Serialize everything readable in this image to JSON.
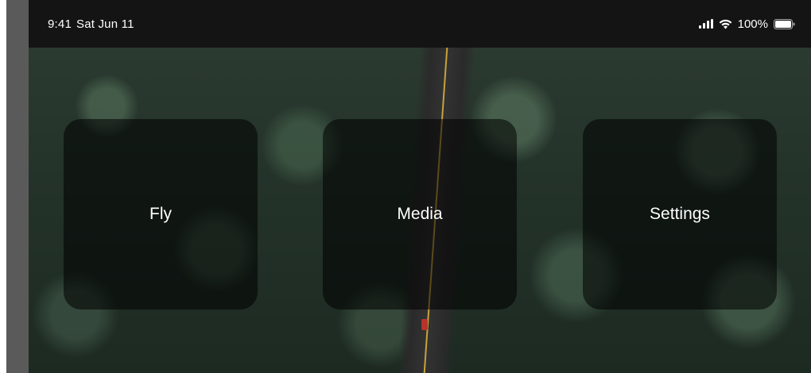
{
  "status_bar": {
    "time": "9:41",
    "date": "Sat Jun 11",
    "battery": "100%"
  },
  "icons": {
    "signal": "cellular-signal-icon",
    "wifi": "wifi-icon",
    "battery": "battery-icon"
  },
  "menu": {
    "fly_label": "Fly",
    "media_label": "Media",
    "settings_label": "Settings"
  },
  "colors": {
    "tile_background": "rgba(0,0,0,0.55)",
    "status_bar": "#141414",
    "text": "#ffffff"
  }
}
